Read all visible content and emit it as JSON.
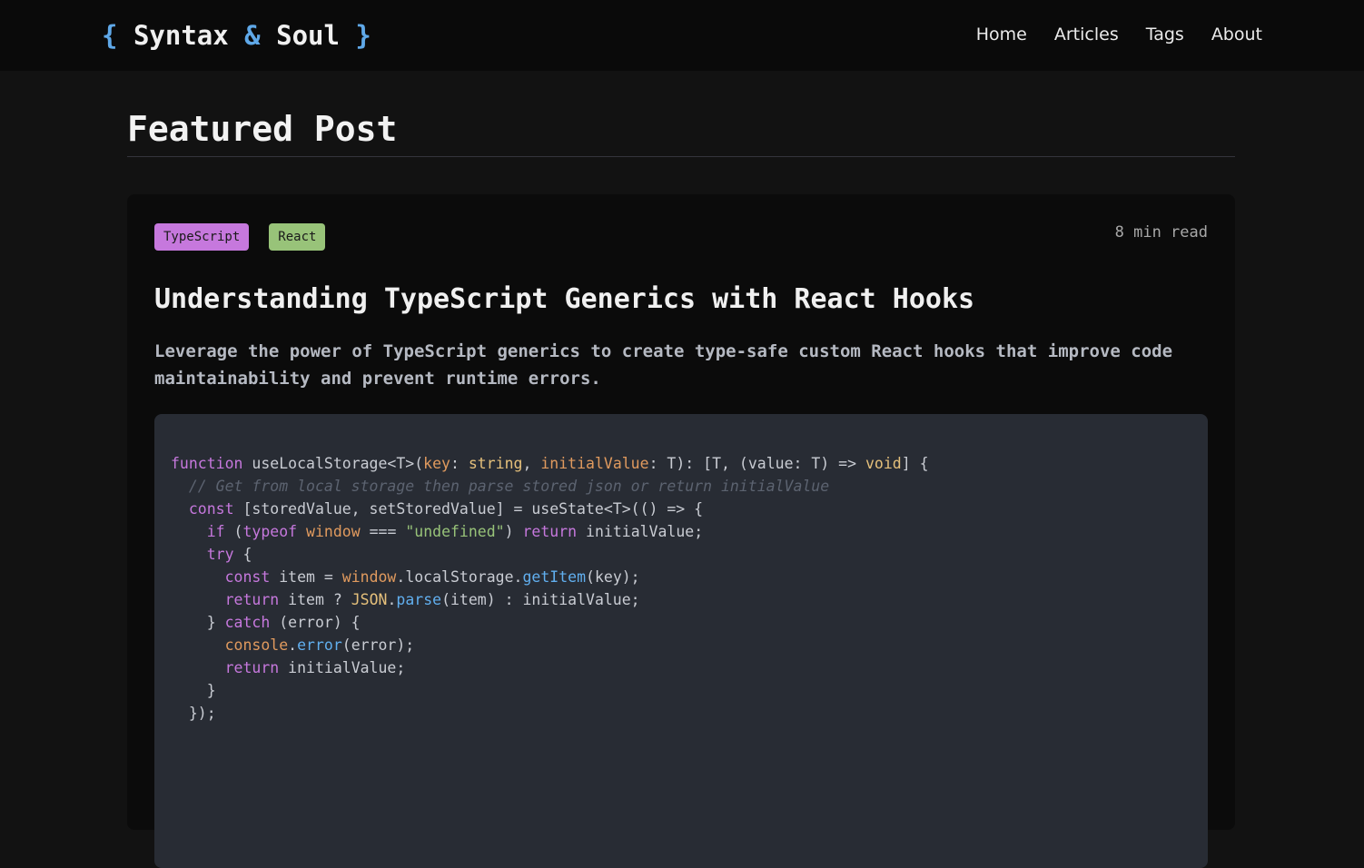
{
  "site": {
    "logo_open": "{",
    "logo_word1": "Syntax",
    "logo_amp": "&",
    "logo_word2": "Soul",
    "logo_close": "}"
  },
  "nav": {
    "items": [
      {
        "label": "Home"
      },
      {
        "label": "Articles"
      },
      {
        "label": "Tags"
      },
      {
        "label": "About"
      }
    ]
  },
  "section": {
    "title": "Featured Post"
  },
  "post": {
    "tags": [
      {
        "label": "TypeScript",
        "color": "#c678dd"
      },
      {
        "label": "React",
        "color": "#98c379"
      }
    ],
    "read_time": "8 min read",
    "title": "Understanding TypeScript Generics with React Hooks",
    "description": "Leverage the power of TypeScript generics to create type-safe custom React hooks that improve code maintainability and prevent runtime errors."
  },
  "code": {
    "language": "typescript",
    "colors": {
      "keyword": "#c678dd",
      "type": "#e5c07b",
      "param": "#e09a5e",
      "string": "#98c379",
      "function": "#61afef",
      "comment": "#5c6370",
      "plain": "#c9ccd3"
    },
    "lines": [
      [
        [
          "kw",
          "function"
        ],
        [
          "plain",
          " useLocalStorage<T>("
        ],
        [
          "param",
          "key"
        ],
        [
          "plain",
          ": "
        ],
        [
          "type",
          "string"
        ],
        [
          "plain",
          ", "
        ],
        [
          "param",
          "initialValue"
        ],
        [
          "plain",
          ": T): [T, (value: T) => "
        ],
        [
          "type",
          "void"
        ],
        [
          "plain",
          "] {"
        ]
      ],
      [
        [
          "plain",
          "  "
        ],
        [
          "com",
          "// Get from local storage then parse stored json or return initialValue"
        ]
      ],
      [
        [
          "plain",
          "  "
        ],
        [
          "kw",
          "const"
        ],
        [
          "plain",
          " [storedValue, setStoredValue] = useState<T>(() => {"
        ]
      ],
      [
        [
          "plain",
          "    "
        ],
        [
          "kw",
          "if"
        ],
        [
          "plain",
          " ("
        ],
        [
          "kw",
          "typeof"
        ],
        [
          "plain",
          " "
        ],
        [
          "param",
          "window"
        ],
        [
          "plain",
          " === "
        ],
        [
          "str",
          "\"undefined\""
        ],
        [
          "plain",
          ") "
        ],
        [
          "kw",
          "return"
        ],
        [
          "plain",
          " initialValue;"
        ]
      ],
      [
        [
          "plain",
          "    "
        ],
        [
          "kw",
          "try"
        ],
        [
          "plain",
          " {"
        ]
      ],
      [
        [
          "plain",
          "      "
        ],
        [
          "kw",
          "const"
        ],
        [
          "plain",
          " item = "
        ],
        [
          "param",
          "window"
        ],
        [
          "plain",
          "."
        ],
        [
          "plain",
          "localStorage"
        ],
        [
          "plain",
          "."
        ],
        [
          "fn",
          "getItem"
        ],
        [
          "plain",
          "(key);"
        ]
      ],
      [
        [
          "plain",
          "      "
        ],
        [
          "kw",
          "return"
        ],
        [
          "plain",
          " item ? "
        ],
        [
          "type",
          "JSON"
        ],
        [
          "plain",
          "."
        ],
        [
          "fn",
          "parse"
        ],
        [
          "plain",
          "(item) : initialValue;"
        ]
      ],
      [
        [
          "plain",
          "    } "
        ],
        [
          "kw",
          "catch"
        ],
        [
          "plain",
          " (error) {"
        ]
      ],
      [
        [
          "plain",
          "      "
        ],
        [
          "param",
          "console"
        ],
        [
          "plain",
          "."
        ],
        [
          "fn",
          "error"
        ],
        [
          "plain",
          "(error);"
        ]
      ],
      [
        [
          "plain",
          "      "
        ],
        [
          "kw",
          "return"
        ],
        [
          "plain",
          " initialValue;"
        ]
      ],
      [
        [
          "plain",
          "    }"
        ]
      ],
      [
        [
          "plain",
          "  });"
        ]
      ]
    ]
  }
}
